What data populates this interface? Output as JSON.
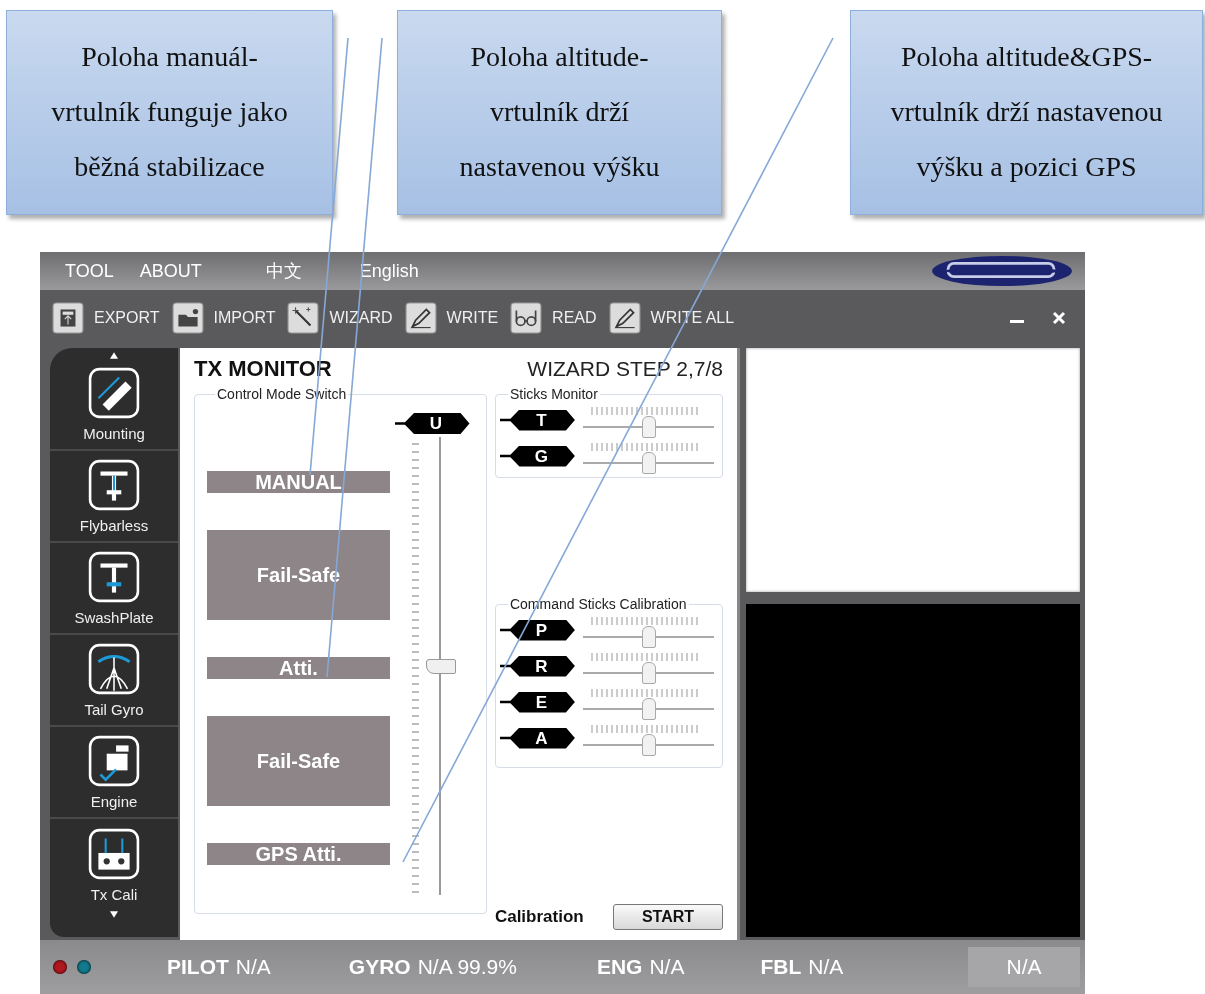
{
  "callouts": [
    {
      "text": "Poloha manuál-\nvrtulník funguje jako\nběžná stabilizace"
    },
    {
      "text": "Poloha altitude-\nvrtulník drží\nnastavenou výšku"
    },
    {
      "text": "Poloha altitude&GPS-\nvrtulník drží nastavenou\nvýšku a pozici GPS"
    }
  ],
  "menu": [
    "TOOL",
    "ABOUT",
    "中文",
    "English"
  ],
  "toolbar": [
    {
      "label": "EXPORT",
      "kind": "export"
    },
    {
      "label": "IMPORT",
      "kind": "import"
    },
    {
      "label": "WIZARD",
      "kind": "wizard"
    },
    {
      "label": "WRITE",
      "kind": "write"
    },
    {
      "label": "READ",
      "kind": "read"
    },
    {
      "label": "WRITE ALL",
      "kind": "write"
    }
  ],
  "sidebar": [
    {
      "label": "Mounting",
      "kind": "mounting"
    },
    {
      "label": "Flybarless",
      "kind": "flybarless"
    },
    {
      "label": "SwashPlate",
      "kind": "swashplate"
    },
    {
      "label": "Tail Gyro",
      "kind": "tailgyro"
    },
    {
      "label": "Engine",
      "kind": "engine"
    },
    {
      "label": "Tx Cali",
      "kind": "tx"
    }
  ],
  "monitor": {
    "title": "TX MONITOR",
    "step": "WIZARD STEP 2,7/8",
    "mode_switch": {
      "title": "Control Mode Switch",
      "modes": [
        {
          "label": "MANUAL",
          "kind": "mode"
        },
        {
          "label": "Fail-Safe",
          "kind": "failsafe"
        },
        {
          "label": "Atti.",
          "kind": "mode"
        },
        {
          "label": "Fail-Safe",
          "kind": "failsafe"
        },
        {
          "label": "GPS Atti.",
          "kind": "mode"
        }
      ],
      "channel": "U",
      "level": 0.5
    },
    "sticks_monitor": {
      "title": "Sticks Monitor",
      "channels": [
        {
          "name": "T",
          "level": 0.5
        },
        {
          "name": "G",
          "level": 0.5
        }
      ]
    },
    "calibration": {
      "title": "Command Sticks Calibration",
      "channels": [
        {
          "name": "P",
          "level": 0.5
        },
        {
          "name": "R",
          "level": 0.5
        },
        {
          "name": "E",
          "level": 0.5
        },
        {
          "name": "A",
          "level": 0.5
        }
      ]
    },
    "calibration_label": "Calibration",
    "start_button": "START"
  },
  "status_bar": {
    "leds": [
      {
        "color": "#b01820"
      },
      {
        "color": "#127a8c"
      }
    ],
    "items": [
      {
        "label": "PILOT",
        "value": "N/A"
      },
      {
        "label": "GYRO",
        "value": "N/A 99.9%"
      },
      {
        "label": "ENG",
        "value": "N/A"
      },
      {
        "label": "FBL",
        "value": "N/A"
      }
    ],
    "last": "N/A"
  }
}
